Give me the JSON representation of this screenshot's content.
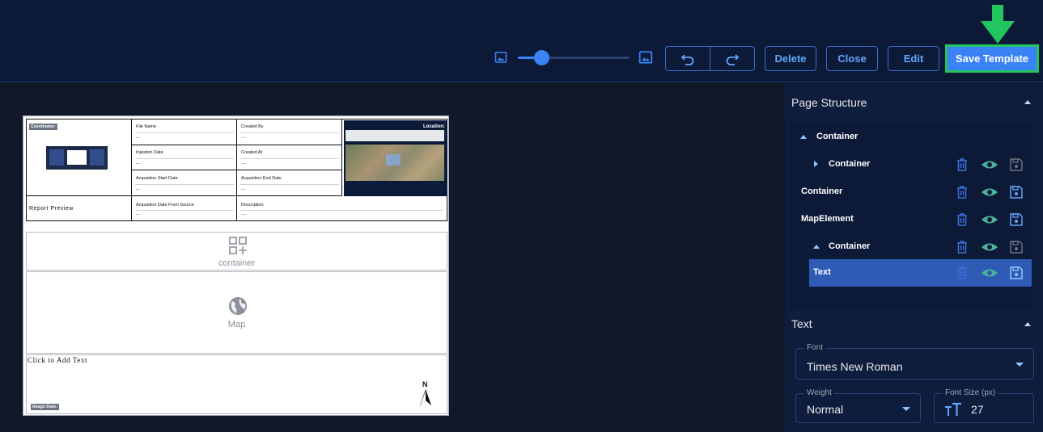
{
  "toolbar": {
    "delete_label": "Delete",
    "close_label": "Close",
    "edit_label": "Edit",
    "save_label": "Save Template",
    "zoom_level": 0.2,
    "accent_color": "#3b82f6",
    "highlight_color": "#22c55e"
  },
  "preview": {
    "coordinates_badge": "Coordinates:",
    "fields": [
      {
        "label": "File Name",
        "value": "---"
      },
      {
        "label": "Created By",
        "value": "---"
      },
      {
        "label": "Injestion Date",
        "value": "---"
      },
      {
        "label": "Created At",
        "value": "---"
      },
      {
        "label": "Acquistion Start Date",
        "value": "---"
      },
      {
        "label": "Acquistion End Date",
        "value": "---"
      },
      {
        "label": "Acquistion Date From Source",
        "value": "---"
      },
      {
        "label": "Description",
        "value": "---"
      }
    ],
    "report_preview": "Report Preview",
    "location_label": "Location:",
    "container_label": "container",
    "map_label": "Map",
    "click_text": "Click to Add Text",
    "north_label": "N",
    "image_date_badge": "Image Date:"
  },
  "panel": {
    "page_structure_title": "Page Structure",
    "tree": [
      {
        "label": "Container",
        "expander": "expanded",
        "actions": false
      },
      {
        "label": "Container",
        "expander": "collapsed",
        "actions": true
      },
      {
        "label": "Container",
        "expander": "none",
        "actions": true
      },
      {
        "label": "MapElement",
        "expander": "none",
        "actions": true
      },
      {
        "label": "Container",
        "expander": "expanded",
        "actions": true
      },
      {
        "label": "Text",
        "expander": "none",
        "actions": true,
        "selected": true
      }
    ],
    "text_section_title": "Text",
    "font": {
      "legend": "Font",
      "value": "Times New Roman"
    },
    "weight": {
      "legend": "Weight",
      "value": "Normal"
    },
    "font_size": {
      "legend": "Font Size (px)",
      "value": "27"
    }
  }
}
